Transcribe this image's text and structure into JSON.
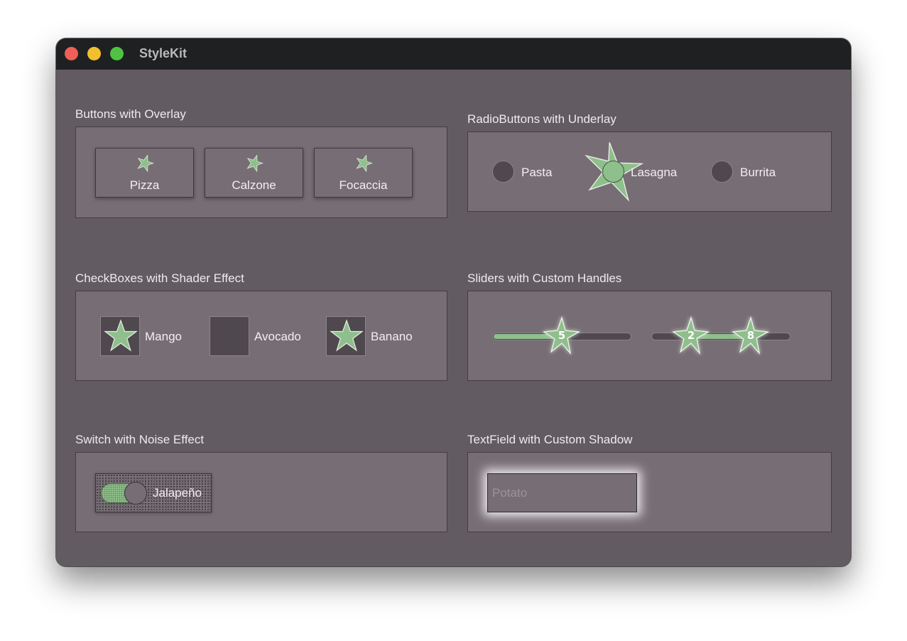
{
  "window": {
    "title": "StyleKit"
  },
  "sections": {
    "buttons": {
      "label": "Buttons with Overlay",
      "items": [
        "Pizza",
        "Calzone",
        "Focaccia"
      ]
    },
    "radios": {
      "label": "RadioButtons with Underlay",
      "items": [
        "Pasta",
        "Lasagna",
        "Burrita"
      ],
      "selected": "Lasagna"
    },
    "checkboxes": {
      "label": "CheckBoxes with Shader Effect",
      "items": [
        {
          "label": "Mango",
          "checked": true
        },
        {
          "label": "Avocado",
          "checked": false
        },
        {
          "label": "Banano",
          "checked": true
        }
      ]
    },
    "sliders": {
      "label": "Sliders with Custom Handles",
      "single": {
        "value": "5",
        "fraction": 0.5
      },
      "range": {
        "low": "2",
        "high": "8",
        "low_fraction": 0.2,
        "high_fraction": 0.8
      }
    },
    "switch": {
      "label": "Switch with Noise Effect",
      "item_label": "Jalapeño",
      "on": true
    },
    "textfield": {
      "label": "TextField with Custom Shadow",
      "placeholder": "Potato",
      "value": ""
    }
  },
  "colors": {
    "window_bg": "#625b61",
    "panel_bg": "#776d75",
    "accent_green": "#8fbf8c",
    "titlebar": "#1f2022"
  },
  "icons": {
    "star": "star-icon"
  }
}
